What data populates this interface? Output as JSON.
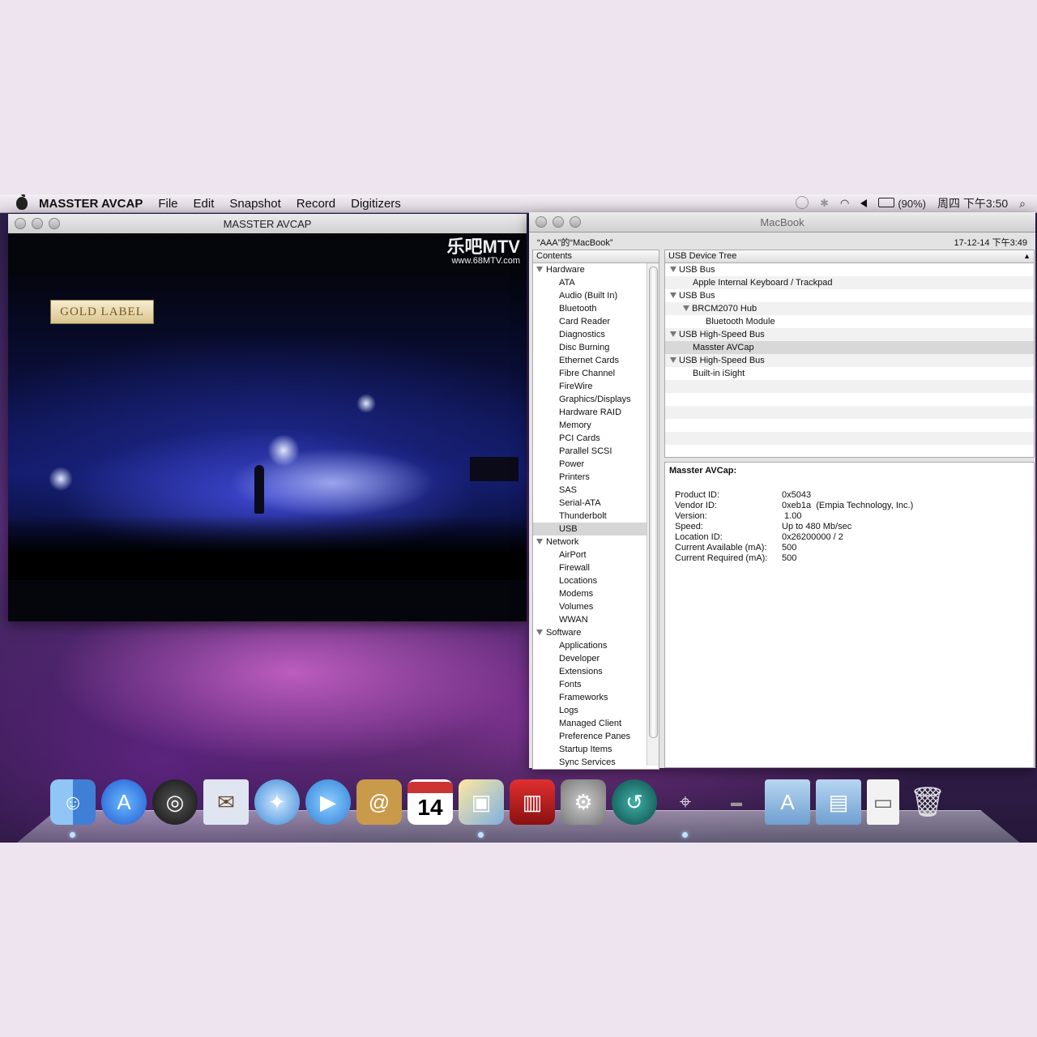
{
  "menubar": {
    "app_name": "MASSTER AVCAP",
    "items": [
      "File",
      "Edit",
      "Snapshot",
      "Record",
      "Digitizers"
    ],
    "battery": "(90%)",
    "clock": "周四 下午3:50"
  },
  "video_window": {
    "title": "MASSTER AVCAP",
    "logo_main": "乐吧MTV",
    "logo_url": "www.68MTV.com",
    "label": "GOLD LABEL"
  },
  "profiler": {
    "title": "MacBook",
    "machine": "“AAA”的“MacBook”",
    "datetime": "17-12-14 下午3:49",
    "contents_header": "Contents",
    "categories": [
      {
        "name": "Hardware",
        "items": [
          "ATA",
          "Audio (Built In)",
          "Bluetooth",
          "Card Reader",
          "Diagnostics",
          "Disc Burning",
          "Ethernet Cards",
          "Fibre Channel",
          "FireWire",
          "Graphics/Displays",
          "Hardware RAID",
          "Memory",
          "PCI Cards",
          "Parallel SCSI",
          "Power",
          "Printers",
          "SAS",
          "Serial-ATA",
          "Thunderbolt",
          "USB"
        ]
      },
      {
        "name": "Network",
        "items": [
          "AirPort",
          "Firewall",
          "Locations",
          "Modems",
          "Volumes",
          "WWAN"
        ]
      },
      {
        "name": "Software",
        "items": [
          "Applications",
          "Developer",
          "Extensions",
          "Fonts",
          "Frameworks",
          "Logs",
          "Managed Client",
          "Preference Panes",
          "Startup Items",
          "Sync Services"
        ]
      }
    ],
    "selected_item": "USB",
    "tree_header": "USB Device Tree",
    "tree": [
      "USB Bus",
      "Apple Internal Keyboard / Trackpad",
      "USB Bus",
      "BRCM2070 Hub",
      "Bluetooth Module",
      "USB High-Speed Bus",
      "Masster AVCap",
      "USB High-Speed Bus",
      "Built-in iSight"
    ],
    "detail_title": "Masster AVCap:",
    "details": [
      {
        "key": "Product ID:",
        "value": "0x5043"
      },
      {
        "key": "Vendor ID:",
        "value": "0xeb1a  (Empia Technology, Inc.)"
      },
      {
        "key": "Version:",
        "value": " 1.00"
      },
      {
        "key": "Speed:",
        "value": "Up to 480 Mb/sec"
      },
      {
        "key": "Location ID:",
        "value": "0x26200000 / 2"
      },
      {
        "key": "Current Available (mA):",
        "value": "500"
      },
      {
        "key": "Current Required (mA):",
        "value": "500"
      }
    ]
  },
  "dock": {
    "calendar_day": "14",
    "icons": [
      "finder-icon",
      "app-store-icon",
      "dashboard-icon",
      "mail-icon",
      "safari-icon",
      "ichat-icon",
      "address-book-icon",
      "ical-icon",
      "iphoto-icon",
      "photo-booth-icon",
      "system-preferences-icon",
      "time-machine-icon",
      "masster-avcap-icon",
      "applications-folder-icon",
      "documents-folder-icon",
      "disk-image-icon",
      "trash-icon"
    ]
  }
}
